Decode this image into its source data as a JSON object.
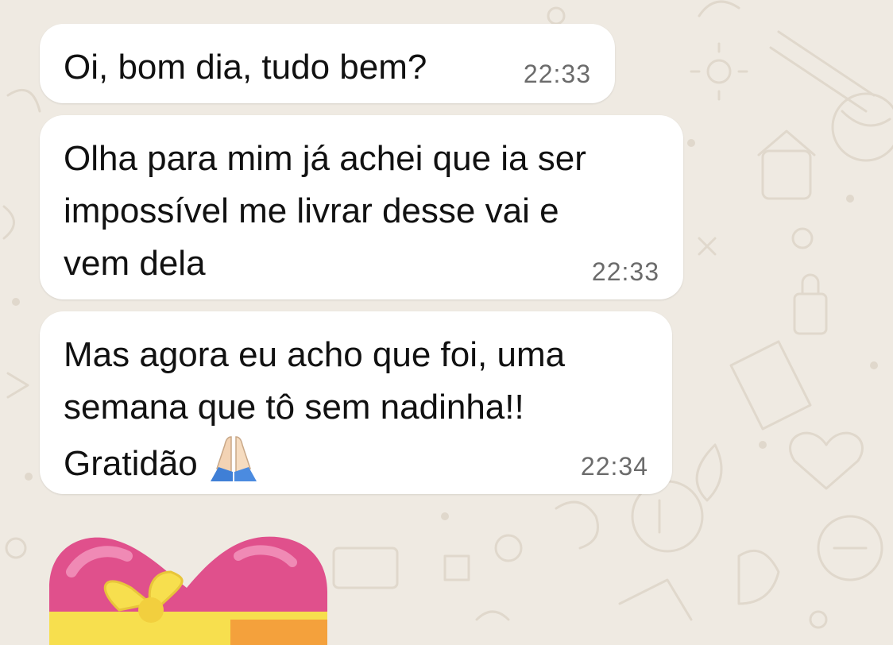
{
  "messages": [
    {
      "text": "Oi, bom dia, tudo bem?",
      "time": "22:33"
    },
    {
      "text": "Olha para mim já achei que ia ser\nimpossível me livrar desse vai e\nvem dela",
      "time": "22:33"
    },
    {
      "text": "Mas agora eu acho que foi, uma\nsemana que tô sem nadinha!!\nGratidão",
      "time": "22:34",
      "emoji": "folded-hands"
    }
  ],
  "sticker": {
    "icon": "heart-with-ribbon"
  },
  "colors": {
    "background": "#efeae2",
    "bubble": "#ffffff",
    "doodle": "#e0d8cc",
    "time_text": "#6b6b6b",
    "heart": "#e0508c",
    "ribbon": "#f7df4e"
  }
}
